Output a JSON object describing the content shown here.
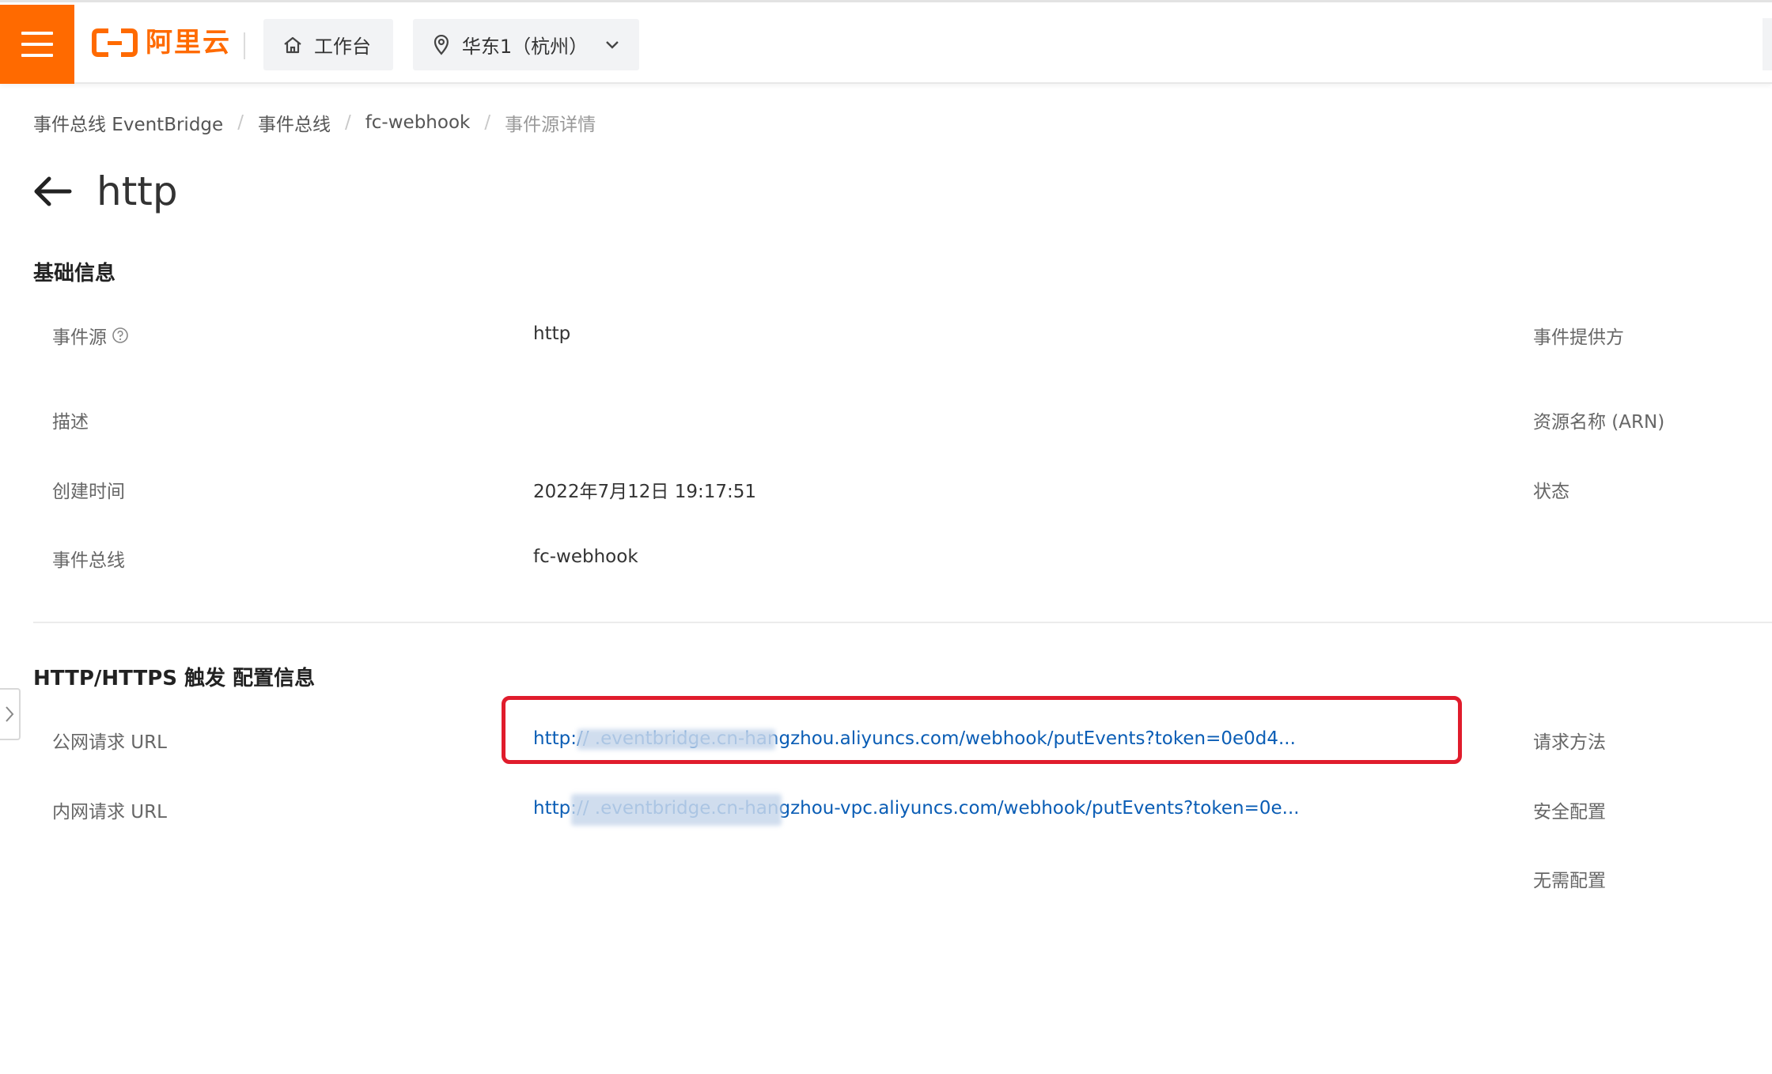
{
  "topbar": {
    "logo_text": "阿里云",
    "workbench_label": "工作台",
    "region_label": "华东1（杭州）",
    "accent_color": "#ff6a00"
  },
  "breadcrumb": {
    "items": [
      "事件总线 EventBridge",
      "事件总线",
      "fc-webhook",
      "事件源详情"
    ],
    "separator": "/"
  },
  "page": {
    "title": "http"
  },
  "basic_info": {
    "section_title": "基础信息",
    "rows": [
      {
        "label": "事件源",
        "value": "http",
        "right_label": "事件提供方"
      },
      {
        "label": "描述",
        "value": "",
        "right_label": "资源名称 (ARN)"
      },
      {
        "label": "创建时间",
        "value": "2022年7月12日 19:17:51",
        "right_label": "状态"
      },
      {
        "label": "事件总线",
        "value": "fc-webhook",
        "right_label": ""
      }
    ]
  },
  "http_config": {
    "section_title": "HTTP/HTTPS 触发 配置信息",
    "rows": [
      {
        "label": "公网请求 URL",
        "value": "http://                    .eventbridge.cn-hangzhou.aliyuncs.com/webhook/putEvents?token=0e0d4...",
        "right_label": "请求方法"
      },
      {
        "label": "内网请求 URL",
        "value": "http://                     .eventbridge.cn-hangzhou-vpc.aliyuncs.com/webhook/putEvents?token=0e...",
        "right_label": "安全配置"
      }
    ],
    "extra_right_label": "无需配置"
  },
  "highlight_color": "#e01c2c",
  "link_color": "#0a5db5"
}
